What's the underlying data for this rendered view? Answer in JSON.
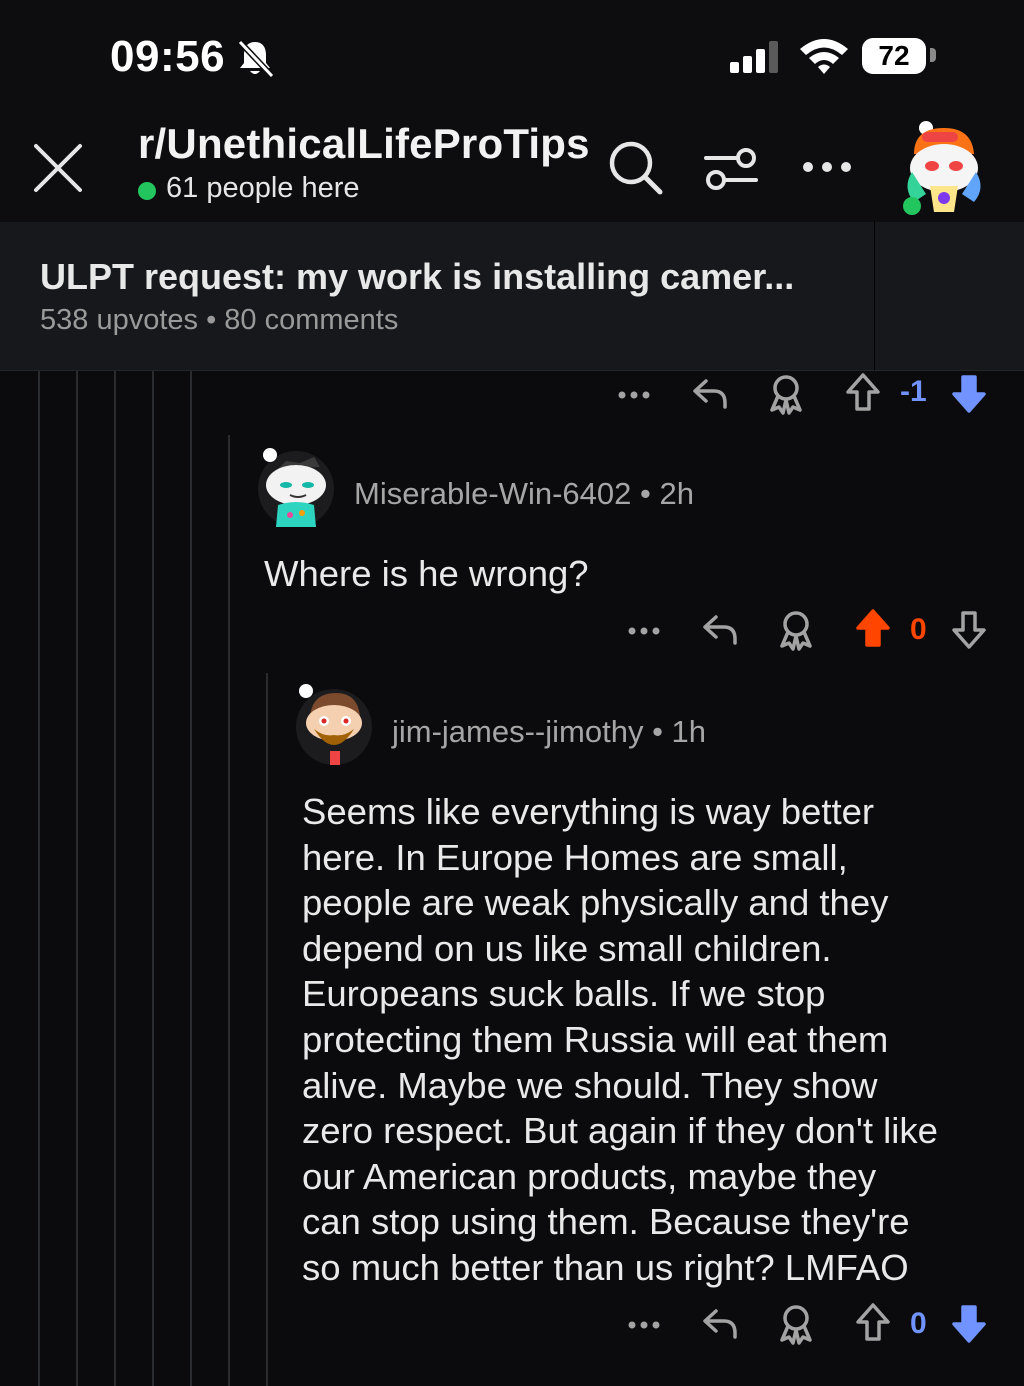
{
  "status_bar": {
    "time": "09:56",
    "battery": "72",
    "icons": [
      "bell-slash-icon",
      "signal-icon",
      "wifi-icon",
      "battery-icon"
    ]
  },
  "header": {
    "subreddit": "r/UnethicalLifeProTips",
    "online": "61 people here",
    "online_color": "#22c55e",
    "icons": [
      "close-icon",
      "search-icon",
      "filter-icon",
      "more-icon",
      "avatar"
    ]
  },
  "post": {
    "title": "ULPT request: my work is installing camer...",
    "meta": "538 upvotes • 80 comments"
  },
  "colors": {
    "upvote_active": "#ff4500",
    "downvote_active": "#7193ff"
  },
  "parent_actions": {
    "vote_count": "-1",
    "vote_state": "downvoted"
  },
  "comments": [
    {
      "author": "Miserable-Win-6402",
      "age": "2h",
      "body": "Where is he wrong?",
      "vote_count": "0",
      "vote_state": "upvoted"
    },
    {
      "author": "jim-james--jimothy",
      "age": "1h",
      "body_lines": [
        "Seems like everything is way better",
        "here. In Europe Homes are small,",
        "people are weak physically and they",
        "depend on us like small children.",
        "Europeans suck balls. If we stop",
        "protecting them Russia will eat them",
        "alive. Maybe we should. They show",
        "zero respect. But again if they don't like",
        "our American products, maybe they",
        "can stop using them. Because they're",
        "so much better than us right? LMFAO"
      ],
      "vote_count": "0",
      "vote_state": "downvoted"
    }
  ]
}
